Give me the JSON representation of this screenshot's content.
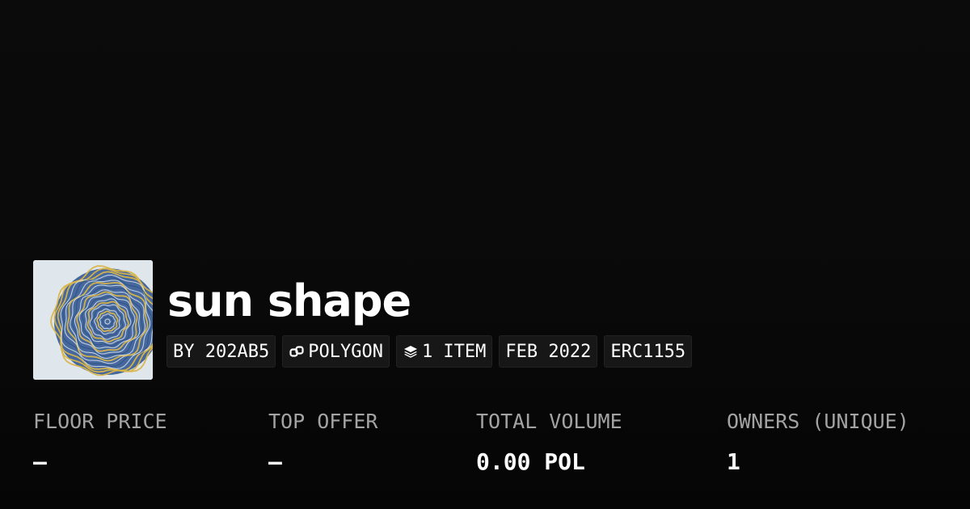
{
  "collection": {
    "name": "sun shape",
    "thumbnail_icon": "concentric-rings-artwork"
  },
  "badges": {
    "creator": "BY 202AB5",
    "chain": "POLYGON",
    "chain_icon": "chain-link-icon",
    "items": "1 ITEM",
    "items_icon": "layers-icon",
    "date": "FEB 2022",
    "standard": "ERC1155"
  },
  "stats": {
    "floor_price": {
      "label": "FLOOR PRICE",
      "value": "–"
    },
    "top_offer": {
      "label": "TOP OFFER",
      "value": "–"
    },
    "total_volume": {
      "label": "TOTAL VOLUME",
      "value": "0.00 POL"
    },
    "owners": {
      "label": "OWNERS (UNIQUE)",
      "value": "1"
    }
  },
  "colors": {
    "background": "#0a0a0a",
    "badge_background": "#171717",
    "label_gray": "#a3a3a3",
    "text": "#ffffff",
    "art_blue": "#2c4f86",
    "art_gold": "#d9b54a"
  }
}
